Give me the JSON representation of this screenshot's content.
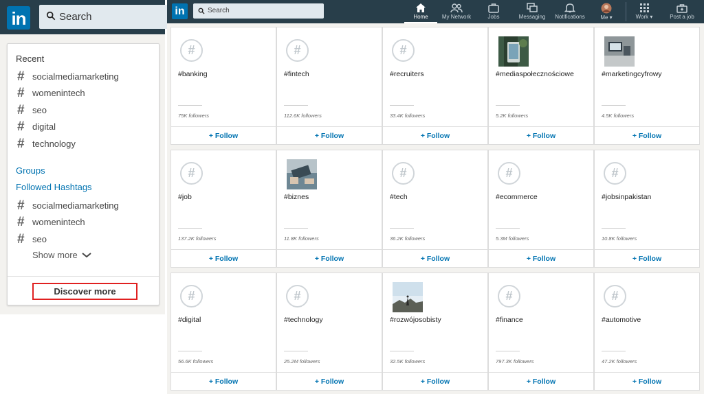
{
  "zoom_panel": {
    "logo_text": "in",
    "search_placeholder": "Search",
    "recent_heading": "Recent",
    "recent": [
      "socialmediamarketing",
      "womenintech",
      "seo",
      "digital",
      "technology"
    ],
    "groups_label": "Groups",
    "followed_hashtags_label": "Followed Hashtags",
    "followed": [
      "socialmediamarketing",
      "womenintech",
      "seo"
    ],
    "show_more_label": "Show more",
    "discover_more_label": "Discover more"
  },
  "nav": {
    "logo_text": "in",
    "search_placeholder": "Search",
    "items": [
      {
        "label": "Home",
        "icon": "home-icon"
      },
      {
        "label": "My Network",
        "icon": "network-icon"
      },
      {
        "label": "Jobs",
        "icon": "briefcase-icon"
      },
      {
        "label": "Messaging",
        "icon": "messaging-icon"
      },
      {
        "label": "Notifications",
        "icon": "bell-icon"
      },
      {
        "label": "Me ▾",
        "icon": "avatar"
      },
      {
        "label": "Work ▾",
        "icon": "grid-icon"
      },
      {
        "label": "Post a job",
        "icon": "post-job-icon"
      }
    ]
  },
  "follow_label": "+ Follow",
  "hashtags": [
    {
      "tag": "#banking",
      "followers": "75K followers",
      "image": "hash-icon"
    },
    {
      "tag": "#fintech",
      "followers": "112.6K followers",
      "image": "hash-icon"
    },
    {
      "tag": "#recruiters",
      "followers": "33.4K followers",
      "image": "hash-icon"
    },
    {
      "tag": "#mediaspołecznościowe",
      "followers": "5.2K followers",
      "image": "phone-photo"
    },
    {
      "tag": "#marketingcyfrowy",
      "followers": "4.5K followers",
      "image": "desk-photo"
    },
    {
      "tag": "#job",
      "followers": "137.2K followers",
      "image": "hash-icon"
    },
    {
      "tag": "#biznes",
      "followers": "11.8K followers",
      "image": "laptop-photo"
    },
    {
      "tag": "#tech",
      "followers": "36.2K followers",
      "image": "hash-icon"
    },
    {
      "tag": "#ecommerce",
      "followers": "5.3M followers",
      "image": "hash-icon"
    },
    {
      "tag": "#jobsinpakistan",
      "followers": "10.8K followers",
      "image": "hash-icon"
    },
    {
      "tag": "#digital",
      "followers": "56.6K followers",
      "image": "hash-icon"
    },
    {
      "tag": "#technology",
      "followers": "25.2M followers",
      "image": "hash-icon"
    },
    {
      "tag": "#rozwójosobisty",
      "followers": "32.5K followers",
      "image": "mountain-photo"
    },
    {
      "tag": "#finance",
      "followers": "797.3K followers",
      "image": "hash-icon"
    },
    {
      "tag": "#automotive",
      "followers": "47.2K followers",
      "image": "hash-icon"
    }
  ],
  "colors": {
    "nav_bg": "#283e4a",
    "brand_blue": "#0073b1",
    "highlight_red": "#e02020"
  }
}
